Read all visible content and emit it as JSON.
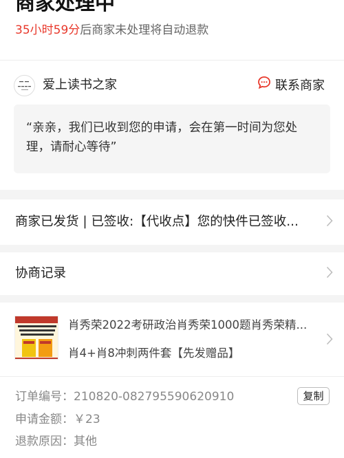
{
  "status": {
    "title": "商家处理中",
    "countdown": "35小时59分",
    "countdown_suffix": "后商家未处理将自动退款"
  },
  "merchant": {
    "name": "爱上读书之家",
    "logo_text": [
      "爱上",
      "读书之家"
    ],
    "contact_label": "联系商家",
    "message": "“亲亲，我们已收到您的申请，会在第一时间为您处理，请耐心等待”"
  },
  "logistics": {
    "text": "商家已发货 | 已签收:【代收点】您的快件已签收..."
  },
  "negotiation": {
    "label": "协商记录"
  },
  "order": {
    "product_title": "肖秀荣2022考研政治肖秀荣1000题肖秀荣精...",
    "product_spec": "肖4+肖8冲刺两件套【先发赠品】",
    "fields": [
      {
        "label": "订单编号：",
        "value": "210820-082795590620910"
      },
      {
        "label": "申请金额：",
        "value": "￥23"
      },
      {
        "label": "退款原因：",
        "value": "其他"
      }
    ],
    "copy_label": "复制"
  },
  "colors": {
    "accent": "#e8382b",
    "muted": "#888888"
  },
  "icons": {
    "contact": "chat-bubble-icon",
    "row_arrow": "chevron-right-icon"
  }
}
